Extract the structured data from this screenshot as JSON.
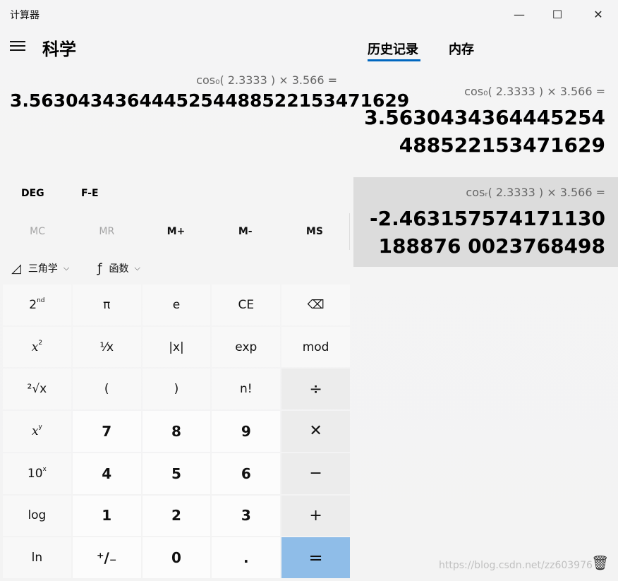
{
  "window": {
    "title": "计算器",
    "minimize_glyph": "—",
    "maximize_glyph": "☐",
    "close_glyph": "✕"
  },
  "header": {
    "mode_title": "科学"
  },
  "tabs": {
    "history_label": "历史记录",
    "memory_label": "内存"
  },
  "display": {
    "expression": "cos₀( 2.3333 ) × 3.566 =",
    "result": "3.5630434364445254488522153471629"
  },
  "modes": {
    "angle": "DEG",
    "fe": "F-E"
  },
  "memory_buttons": [
    {
      "label": "MC",
      "enabled": false
    },
    {
      "label": "MR",
      "enabled": false
    },
    {
      "label": "M+",
      "enabled": true
    },
    {
      "label": "M-",
      "enabled": true
    },
    {
      "label": "MS",
      "enabled": true
    }
  ],
  "function_row": {
    "trig_icon": "◿",
    "trig_label": "三角学",
    "func_icon": "ƒ",
    "func_label": "函数",
    "chevron": "⌵"
  },
  "keys": {
    "r1": [
      "2",
      "nd",
      "π",
      "e",
      "CE",
      "⌫"
    ],
    "r2": [
      "x",
      "2",
      "¹⁄x",
      "|x|",
      "exp",
      "mod"
    ],
    "r3": [
      "²√x",
      "(",
      ")",
      "n!",
      "÷"
    ],
    "r4": [
      "x",
      "y",
      "7",
      "8",
      "9",
      "✕"
    ],
    "r5": [
      "10",
      "x",
      "4",
      "5",
      "6",
      "−"
    ],
    "r6": [
      "log",
      "1",
      "2",
      "3",
      "+"
    ],
    "r7": [
      "ln",
      "⁺∕₋",
      "0",
      ".",
      "="
    ]
  },
  "history": [
    {
      "expression": "cos₀( 2.3333 )   ×   3.566 =",
      "result": "3.5630434364445254488522153471629"
    },
    {
      "expression": "cosᵣ( 2.3333 )   ×   3.566 =",
      "result": "-2.463157574171130188876 0023768498"
    }
  ],
  "footer": {
    "trash_glyph": "🗑",
    "watermark": "https://blog.csdn.net/zz603976"
  }
}
